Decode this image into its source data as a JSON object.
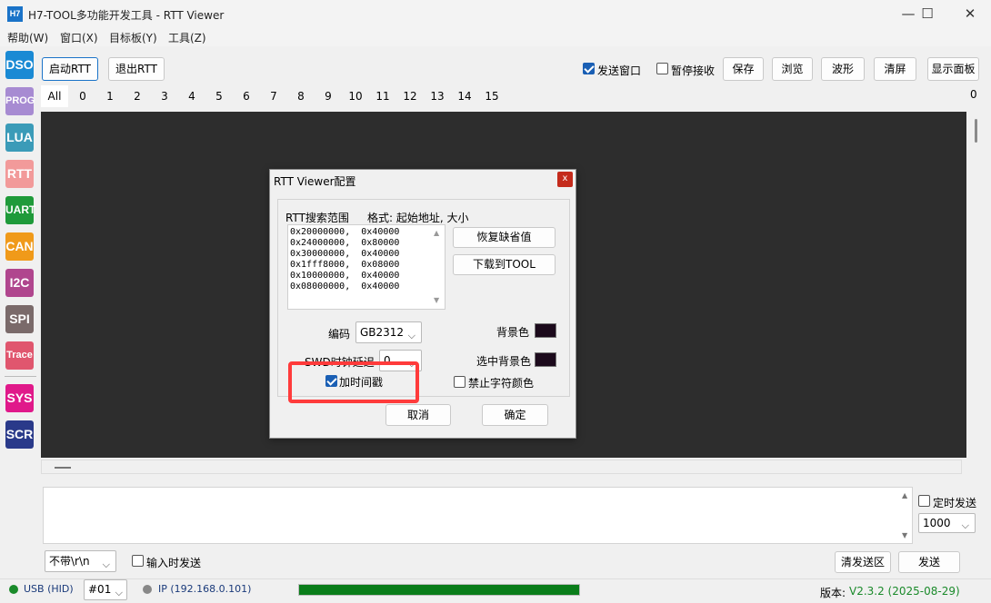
{
  "window": {
    "app_icon_text": "H7",
    "title": "H7-TOOL多功能开发工具 - RTT Viewer",
    "minimize": "—",
    "maximize": "☐",
    "close": "✕"
  },
  "menu": [
    "帮助(W)",
    "窗口(X)",
    "目标板(Y)",
    "工具(Z)"
  ],
  "rail": [
    {
      "label": "DSO",
      "color": "#1a8ad4"
    },
    {
      "label": "PROG",
      "color": "#a78bd2"
    },
    {
      "label": "LUA",
      "color": "#3b9bb8"
    },
    {
      "label": "RTT",
      "color": "#f29a9a"
    },
    {
      "label": "UART",
      "color": "#1f9a3a"
    },
    {
      "label": "CAN",
      "color": "#f09a1a"
    },
    {
      "label": "I2C",
      "color": "#b0468e"
    },
    {
      "label": "SPI",
      "color": "#7a6a6a"
    },
    {
      "label": "Trace",
      "color": "#e0566e"
    },
    {
      "label": "SYS",
      "color": "#e0198a"
    },
    {
      "label": "SCR",
      "color": "#2a3a8a"
    }
  ],
  "toolbar": {
    "start_rtt": "启动RTT",
    "exit_rtt": "退出RTT",
    "send_window_label": "发送窗口",
    "pause_recv_label": "暂停接收",
    "save": "保存",
    "browse": "浏览",
    "waveform": "波形",
    "clear": "清屏",
    "show_panel": "显示面板"
  },
  "tabs": [
    "All",
    "0",
    "1",
    "2",
    "3",
    "4",
    "5",
    "6",
    "7",
    "8",
    "9",
    "10",
    "11",
    "12",
    "13",
    "14",
    "15"
  ],
  "tab_counter": "0",
  "send": {
    "timed_send_label": "定时发送",
    "interval_value": "1000",
    "line_ending_value": "不带\\r\\n",
    "send_on_input_label": "输入时发送",
    "clear_send_area": "清发送区",
    "send_button": "发送"
  },
  "status": {
    "usb": "USB (HID)",
    "device": "#01",
    "ip": "IP (192.168.0.101)",
    "progress_fraction": 1.0,
    "version_label": "版本:",
    "version_value": "V2.3.2 (2025-08-29)",
    "usb_dot_color": "#1a8a2a",
    "ip_dot_color": "#888888",
    "version_color": "#1a8a2a"
  },
  "dialog": {
    "title": "RTT Viewer配置",
    "close": "x",
    "search_range_label": "RTT搜索范围",
    "format_label": "格式: 起始地址, 大小",
    "ranges": [
      "0x20000000,  0x40000",
      "0x24000000,  0x80000",
      "0x30000000,  0x40000",
      "0x1fff8000,  0x08000",
      "0x10000000,  0x40000",
      "0x08000000,  0x40000"
    ],
    "restore_defaults": "恢复缺省值",
    "download_to_tool": "下载到TOOL",
    "encoding_label": "编码",
    "encoding_value": "GB2312",
    "bg_color_label": "背景色",
    "swd_delay_label": "SWD时钟延迟",
    "swd_delay_value": "0",
    "selected_bg_label": "选中背景色",
    "timestamp_label": "加时间戳",
    "disable_char_color_label": "禁止字符颜色",
    "cancel": "取消",
    "ok": "确定",
    "swatch_color": "#1c0a1c"
  }
}
